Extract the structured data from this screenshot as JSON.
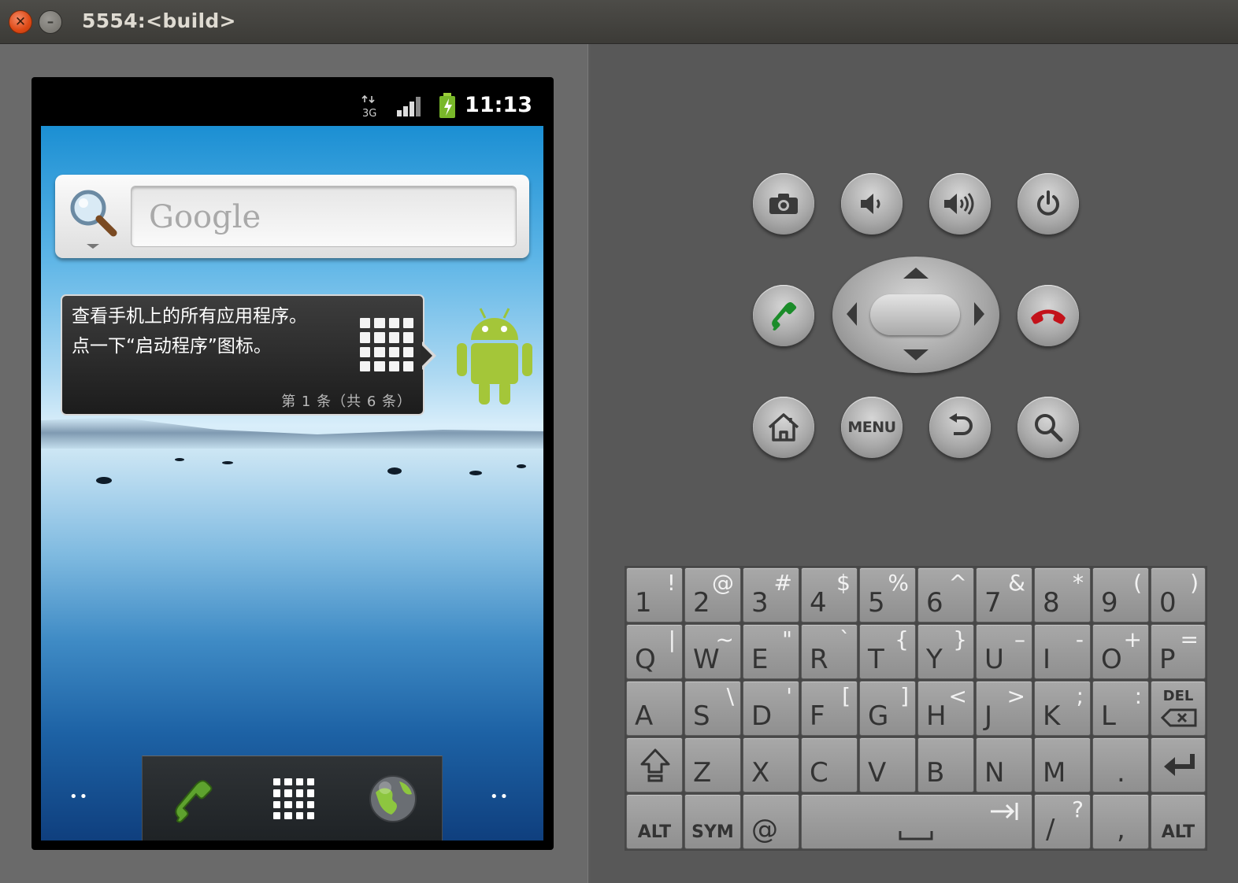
{
  "window": {
    "title": "5554:<build>",
    "close_glyph": "✕",
    "min_glyph": "–"
  },
  "status_bar": {
    "time": "11:13",
    "network": "3G",
    "icons": [
      "3g-icon",
      "signal-icon",
      "battery-charging-icon"
    ]
  },
  "search_widget": {
    "placeholder": "Google",
    "icon": "magnifier-icon"
  },
  "tooltip": {
    "line1": "查看手机上的所有应用程序。",
    "line2": "点一下“启动程序”图标。",
    "count": "第 1 条（共 6 条）",
    "icon": "app-grid-icon"
  },
  "mascot": {
    "icon": "android-robot-icon"
  },
  "dock": {
    "left_dots": "••",
    "right_dots": "••",
    "items": [
      "phone-icon",
      "launcher-grid-icon",
      "browser-globe-icon"
    ]
  },
  "controls": {
    "row1": [
      "camera-icon",
      "volume-down-icon",
      "volume-up-icon",
      "power-icon"
    ],
    "row2": [
      "call-icon",
      "dpad",
      "end-call-icon"
    ],
    "row3": [
      "home-icon",
      "menu-button",
      "back-icon",
      "search-icon"
    ],
    "menu_label": "MENU"
  },
  "keyboard": {
    "row1": [
      {
        "main": "1",
        "alt": "!"
      },
      {
        "main": "2",
        "alt": "@"
      },
      {
        "main": "3",
        "alt": "#"
      },
      {
        "main": "4",
        "alt": "$"
      },
      {
        "main": "5",
        "alt": "%"
      },
      {
        "main": "6",
        "alt": "^"
      },
      {
        "main": "7",
        "alt": "&"
      },
      {
        "main": "8",
        "alt": "*"
      },
      {
        "main": "9",
        "alt": "("
      },
      {
        "main": "0",
        "alt": ")"
      }
    ],
    "row2": [
      {
        "main": "Q",
        "alt": "|"
      },
      {
        "main": "W",
        "alt": "~"
      },
      {
        "main": "E",
        "alt": "\""
      },
      {
        "main": "R",
        "alt": "`"
      },
      {
        "main": "T",
        "alt": "{"
      },
      {
        "main": "Y",
        "alt": "}"
      },
      {
        "main": "U",
        "alt": "–"
      },
      {
        "main": "I",
        "alt": "-"
      },
      {
        "main": "O",
        "alt": "+"
      },
      {
        "main": "P",
        "alt": "="
      }
    ],
    "row3": [
      {
        "main": "A",
        "alt": ""
      },
      {
        "main": "S",
        "alt": "\\"
      },
      {
        "main": "D",
        "alt": "'"
      },
      {
        "main": "F",
        "alt": "["
      },
      {
        "main": "G",
        "alt": "]"
      },
      {
        "main": "H",
        "alt": "<"
      },
      {
        "main": "J",
        "alt": ">"
      },
      {
        "main": "K",
        "alt": ";"
      },
      {
        "main": "L",
        "alt": ":"
      }
    ],
    "del_label": "DEL",
    "row4": [
      {
        "main": "Z",
        "alt": ""
      },
      {
        "main": "X",
        "alt": ""
      },
      {
        "main": "C",
        "alt": ""
      },
      {
        "main": "V",
        "alt": ""
      },
      {
        "main": "B",
        "alt": ""
      },
      {
        "main": "N",
        "alt": ""
      },
      {
        "main": "M",
        "alt": ""
      },
      {
        "main": ".",
        "alt": ""
      }
    ],
    "alt_label": "ALT",
    "sym_label": "SYM",
    "at_label": "@",
    "slash": {
      "main": "/",
      "alt": "?"
    },
    "comma": ","
  }
}
